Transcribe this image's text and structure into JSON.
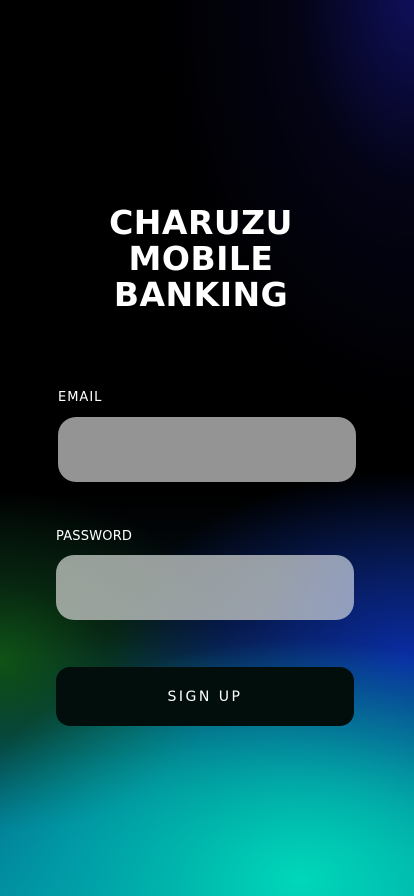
{
  "app": {
    "title_lines": [
      "CHARUZU",
      "MOBILE",
      "BANKING"
    ]
  },
  "form": {
    "email_label": "EMAIL",
    "email_value": "",
    "password_label": "PASSWORD",
    "password_value": "",
    "signup_label": "SIGN UP"
  },
  "colors": {
    "button_background": "#020e0c",
    "field_background": "#bebebe",
    "text": "#ffffff"
  }
}
